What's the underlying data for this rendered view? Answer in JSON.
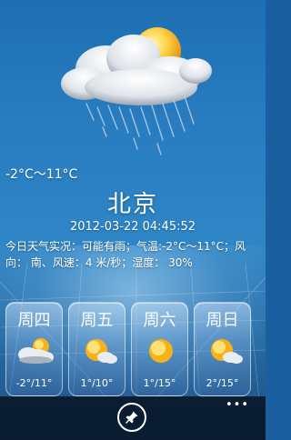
{
  "current": {
    "range": "-2°C～11°C",
    "icon": "cloud-rain-sun-icon"
  },
  "city": "北京",
  "datetime": "2012-03-22 04:45:52",
  "detail": "今日天气实况：可能有雨；气温:-2°C～11°C；风向： 南、风速：4 米/秒；湿度： 30%",
  "forecast": [
    {
      "day": "周四",
      "temp": "-2°/11°",
      "icon": "partly-cloudy-icon"
    },
    {
      "day": "周五",
      "temp": "1°/10°",
      "icon": "sun-cloud-icon"
    },
    {
      "day": "周六",
      "temp": "1°/15°",
      "icon": "sunny-icon"
    },
    {
      "day": "周日",
      "temp": "2°/15°",
      "icon": "sun-cloud-icon"
    }
  ],
  "appbar": {
    "more": "•••",
    "pin_icon": "pin-icon"
  },
  "colors": {
    "sky_top": "#1e6fb4",
    "sky_bottom": "#1c4f80",
    "appbar": "#08142e",
    "sun": "#f7b21a"
  }
}
